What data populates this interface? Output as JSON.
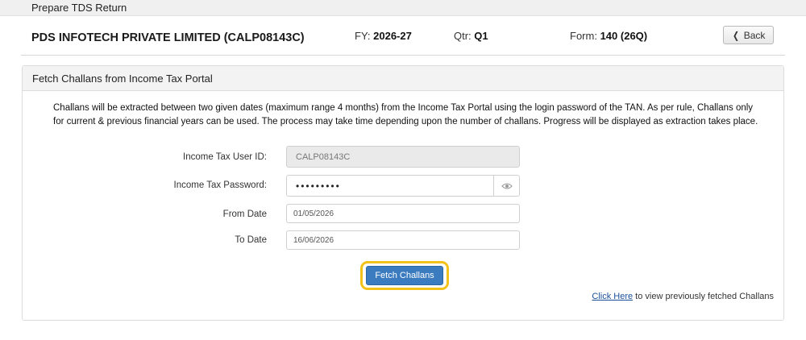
{
  "topbar": {
    "title": "Prepare TDS Return"
  },
  "header": {
    "company": "PDS INFOTECH PRIVATE LIMITED (CALP08143C)",
    "fy_label": "FY:",
    "fy_value": "2026-27",
    "qtr_label": "Qtr:",
    "qtr_value": "Q1",
    "form_label": "Form:",
    "form_value": "140 (26Q)",
    "back_label": "Back"
  },
  "panel": {
    "title": "Fetch Challans from Income Tax Portal",
    "description": "Challans will be extracted between two given dates (maximum range 4 months) from the Income Tax Portal using the login password of the TAN. As per rule, Challans only for current & previous financial years can be used. The process may take time depending upon the number of challans. Progress will be displayed as extraction takes place.",
    "form": {
      "user_id_label": "Income Tax User ID:",
      "user_id_value": "CALP08143C",
      "password_label": "Income Tax Password:",
      "password_value": "•••••••••",
      "from_date_label": "From Date",
      "from_date_value": "01/05/2026",
      "to_date_label": "To Date",
      "to_date_value": "16/06/2026"
    },
    "fetch_button": "Fetch Challans",
    "footer_link": "Click Here",
    "footer_text": " to view previously fetched Challans"
  },
  "icons": {
    "back": "chevron-left-icon",
    "eye": "eye-icon"
  },
  "colors": {
    "primary": "#3b7bbf",
    "highlight": "#f2c21b"
  }
}
